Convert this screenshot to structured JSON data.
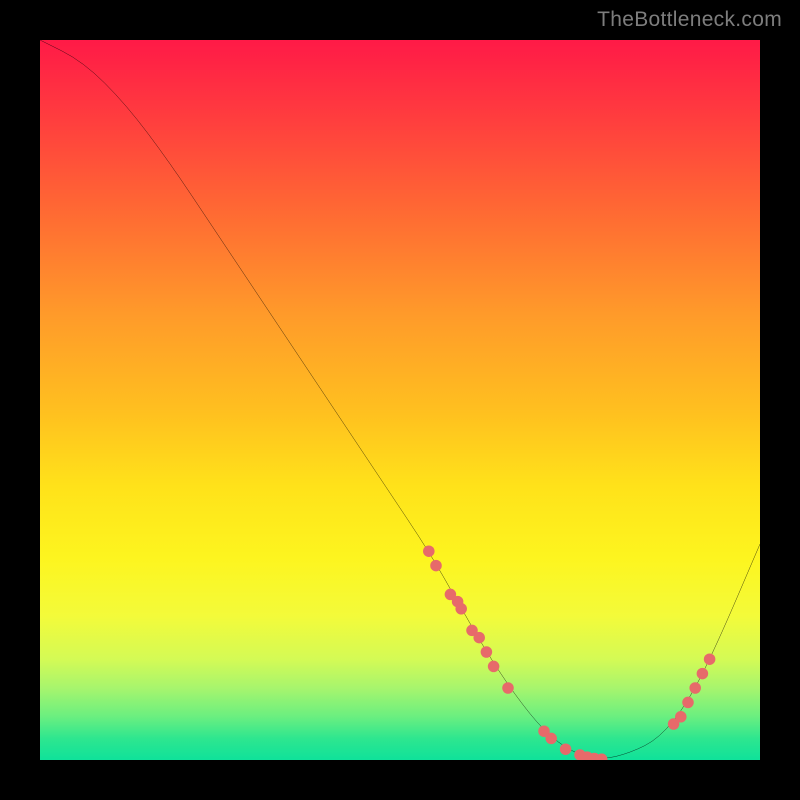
{
  "watermark": "TheBottleneck.com",
  "chart_data": {
    "type": "line",
    "title": "",
    "xlabel": "",
    "ylabel": "",
    "xlim": [
      0,
      100
    ],
    "ylim": [
      0,
      100
    ],
    "curve": {
      "name": "bottleneck-curve",
      "x": [
        0,
        6,
        12,
        18,
        24,
        30,
        36,
        42,
        48,
        54,
        58,
        62,
        66,
        70,
        74,
        78,
        82,
        86,
        90,
        94,
        100
      ],
      "values": [
        100,
        97,
        91,
        83,
        74,
        65,
        56,
        47,
        38,
        29,
        22,
        15,
        9,
        4,
        1,
        0,
        1,
        3,
        8,
        16,
        30
      ]
    },
    "scatter": {
      "name": "sample-points",
      "x": [
        54,
        55,
        57,
        58,
        58.5,
        60,
        61,
        62,
        63,
        65,
        70,
        71,
        73,
        75,
        76,
        77,
        78,
        78,
        88,
        89,
        90,
        91,
        92,
        93
      ],
      "y": [
        29,
        27,
        23,
        22,
        21,
        18,
        17,
        15,
        13,
        10,
        4,
        3,
        1.5,
        0.7,
        0.4,
        0.2,
        0.1,
        0.1,
        5,
        6,
        8,
        10,
        12,
        14
      ]
    },
    "color_map": {
      "top": "#ff1a47",
      "mid": "#ffe21a",
      "bottom": "#0fe29a"
    }
  }
}
